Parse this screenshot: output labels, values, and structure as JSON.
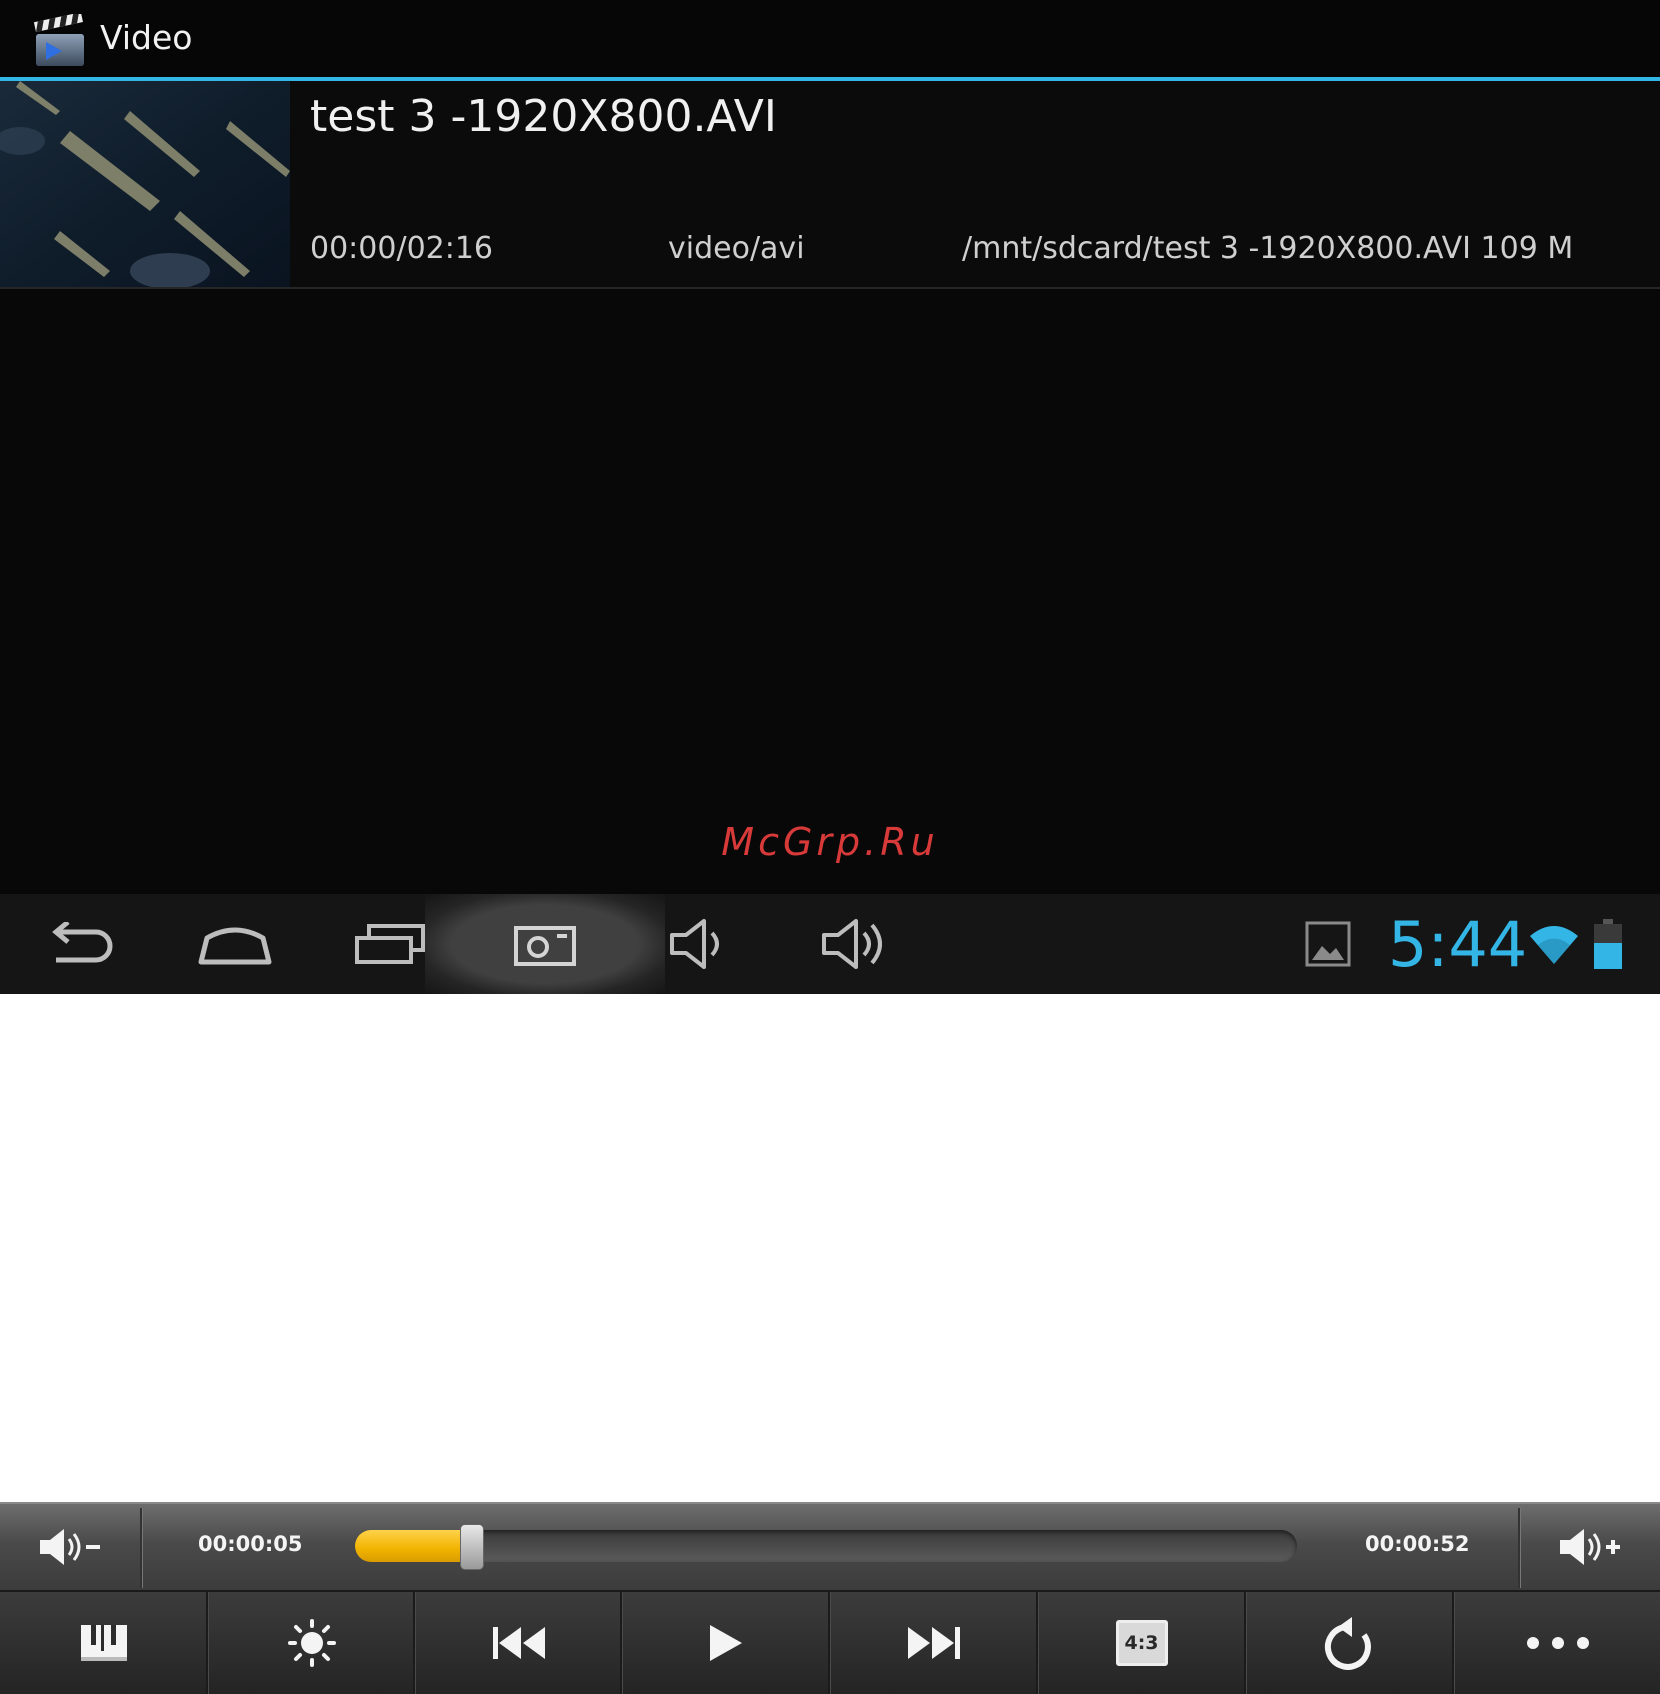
{
  "action_bar": {
    "title": "Video",
    "app_icon": "clapperboard-icon"
  },
  "video_item": {
    "title": "test 3 -1920X800.AVI",
    "duration": "00:00/02:16",
    "mime_type": "video/avi",
    "path_size": "/mnt/sdcard/test 3 -1920X800.AVI 109 M"
  },
  "watermark": "McGrp.Ru",
  "system_bar": {
    "clock": "5:44",
    "buttons": [
      "back-icon",
      "home-icon",
      "recent-apps-icon",
      "screenshot-icon",
      "volume-down-icon",
      "volume-up-icon"
    ],
    "status_icons": [
      "gallery-notification-icon",
      "wifi-icon",
      "battery-icon"
    ],
    "accent_color": "#33b5e5"
  },
  "player": {
    "current_time": "00:00:05",
    "total_time": "00:00:52",
    "progress": 0.12,
    "progress_color": "#f1b300",
    "controls": [
      "playlist-icon",
      "brightness-icon",
      "previous-icon",
      "play-icon",
      "next-icon",
      "aspect-ratio-icon",
      "repeat-icon",
      "more-icon"
    ],
    "aspect_label": "4:3"
  }
}
